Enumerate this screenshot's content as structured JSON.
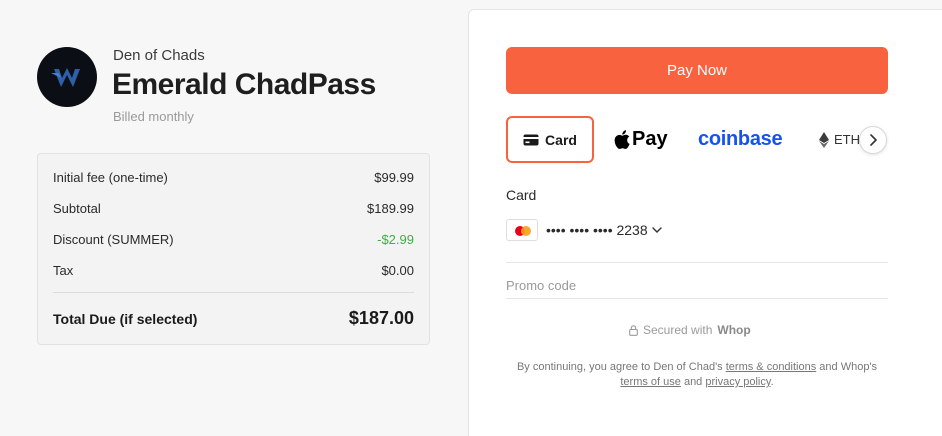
{
  "brand": {
    "company": "Den of Chads",
    "product": "Emerald ChadPass",
    "billing": "Billed monthly",
    "logo_icon": "den-of-chads-logo"
  },
  "summary": {
    "rows": [
      {
        "label": "Initial fee (one-time)",
        "value": "$99.99"
      },
      {
        "label": "Subtotal",
        "value": "$189.99"
      },
      {
        "label": "Discount (SUMMER)",
        "value": "-$2.99"
      },
      {
        "label": "Tax",
        "value": "$0.00"
      }
    ],
    "total_label": "Total Due (if selected)",
    "total_value": "$187.00"
  },
  "checkout": {
    "pay_button": "Pay Now",
    "methods": {
      "card": "Card",
      "apple_pay": "Pay",
      "coinbase": "coinbase",
      "eth": "ETH"
    },
    "card_label": "Card",
    "card_number": "•••• •••• •••• 2238",
    "promo_placeholder": "Promo code",
    "secured_text": "Secured with",
    "secured_brand": "Whop",
    "legal": {
      "prefix": "By continuing, you agree to Den of Chad's ",
      "terms_conditions": "terms & conditions",
      "and1": " and Whop's ",
      "terms_of_use": "terms of use",
      "and2": " and ",
      "privacy_policy": "privacy policy",
      "suffix": "."
    }
  },
  "colors": {
    "accent": "#f9623e",
    "discount": "#3fae48",
    "coinbase": "#1652f0"
  }
}
